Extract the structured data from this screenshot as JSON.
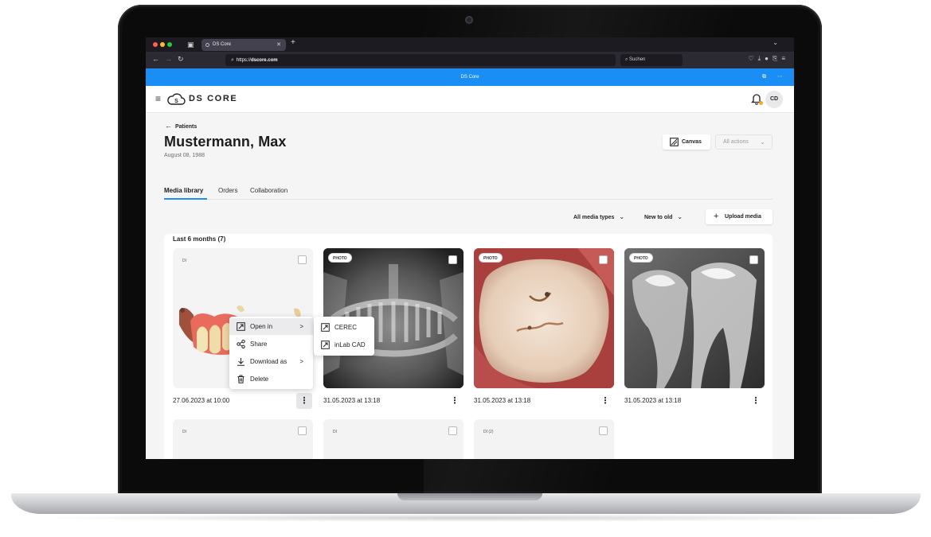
{
  "browser": {
    "tab_title": "DS Core",
    "url_prefix": "https://",
    "url_domain": "dscore.com",
    "search_placeholder": "Suchen",
    "page_title": "DS Core"
  },
  "header": {
    "logo_text": "DS CORE",
    "avatar_initials": "CD"
  },
  "patient": {
    "back_label": "Patients",
    "name": "Mustermann, Max",
    "dob": "August 08, 1988"
  },
  "actions": {
    "canvas_label": "Canvas",
    "all_actions_label": "All actions"
  },
  "tabs": [
    {
      "label": "Media library",
      "active": true
    },
    {
      "label": "Orders",
      "active": false
    },
    {
      "label": "Collaboration",
      "active": false
    }
  ],
  "filters": {
    "media_type": "All media types",
    "sort": "New to old",
    "upload_label": "Upload media"
  },
  "section": {
    "title": "Last 6 months (7)"
  },
  "cards": [
    {
      "badge": "DI",
      "date": "27.06.2023 at 10:00"
    },
    {
      "badge": "PHOTO",
      "date": "31.05.2023 at 13:18"
    },
    {
      "badge": "PHOTO",
      "date": "31.05.2023 at 13:18"
    },
    {
      "badge": "PHOTO",
      "date": "31.05.2023 at 13:18"
    },
    {
      "badge": "DI"
    },
    {
      "badge": "DI"
    },
    {
      "badge": "DI (2)"
    }
  ],
  "context_menu": {
    "items": [
      "Open in",
      "Share",
      "Download as",
      "Delete"
    ]
  },
  "submenu": {
    "items": [
      "CEREC",
      "inLab CAD"
    ]
  },
  "colors": {
    "accent": "#1a8ef5",
    "notification": "#f5a623"
  }
}
